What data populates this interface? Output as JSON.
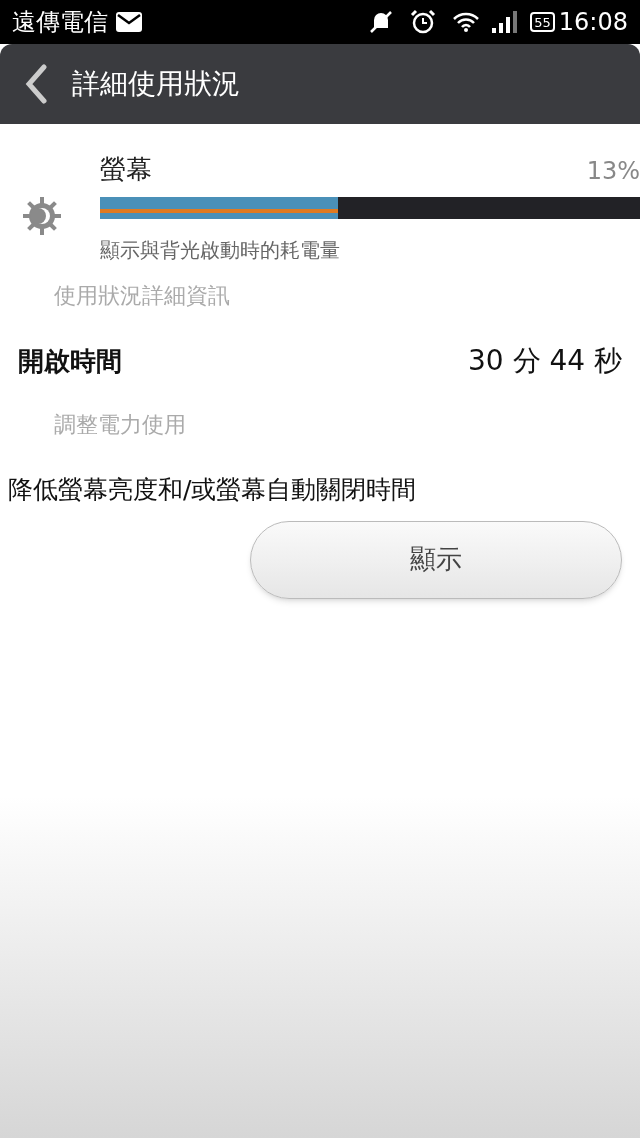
{
  "status_bar": {
    "carrier": "遠傳電信",
    "battery": "55",
    "time": "16:08"
  },
  "header": {
    "title": "詳細使用狀況"
  },
  "usage": {
    "name": "螢幕",
    "percent": "13%",
    "level": 0.44,
    "description": "顯示與背光啟動時的耗電量"
  },
  "details_heading": "使用狀況詳細資訊",
  "details": [
    {
      "label": "開啟時間",
      "value": "30 分 44 秒"
    }
  ],
  "adjust_heading": "調整電力使用",
  "suggestion": "降低螢幕亮度和/或螢幕自動關閉時間",
  "button": "顯示"
}
